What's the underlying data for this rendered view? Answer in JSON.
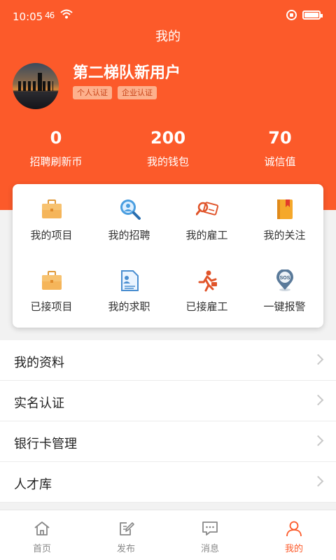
{
  "status_bar": {
    "time": "10:05",
    "signal": "46"
  },
  "page_title": "我的",
  "profile": {
    "username": "第二梯队新用户",
    "tags": [
      "个人认证",
      "企业认证"
    ]
  },
  "stats": [
    {
      "value": "0",
      "label": "招聘刷新币"
    },
    {
      "value": "200",
      "label": "我的钱包"
    },
    {
      "value": "70",
      "label": "诚信值"
    }
  ],
  "grid": [
    {
      "label": "我的项目",
      "icon": "briefcase-icon"
    },
    {
      "label": "我的招聘",
      "icon": "magnifier-person-icon"
    },
    {
      "label": "我的雇工",
      "icon": "search-card-icon"
    },
    {
      "label": "我的关注",
      "icon": "bookmark-book-icon"
    },
    {
      "label": "已接项目",
      "icon": "briefcase-icon"
    },
    {
      "label": "我的求职",
      "icon": "resume-icon"
    },
    {
      "label": "已接雇工",
      "icon": "running-worker-icon"
    },
    {
      "label": "一键报警",
      "icon": "sos-pin-icon"
    }
  ],
  "menu": [
    {
      "label": "我的资料"
    },
    {
      "label": "实名认证"
    },
    {
      "label": "银行卡管理"
    },
    {
      "label": "人才库"
    }
  ],
  "tabs": [
    {
      "label": "首页",
      "icon": "home-icon"
    },
    {
      "label": "发布",
      "icon": "edit-icon"
    },
    {
      "label": "消息",
      "icon": "message-icon"
    },
    {
      "label": "我的",
      "icon": "person-icon"
    }
  ],
  "colors": {
    "brand": "#fc5a2a",
    "tag_bg": "#fdb08c",
    "tag_text": "#c7441a"
  }
}
